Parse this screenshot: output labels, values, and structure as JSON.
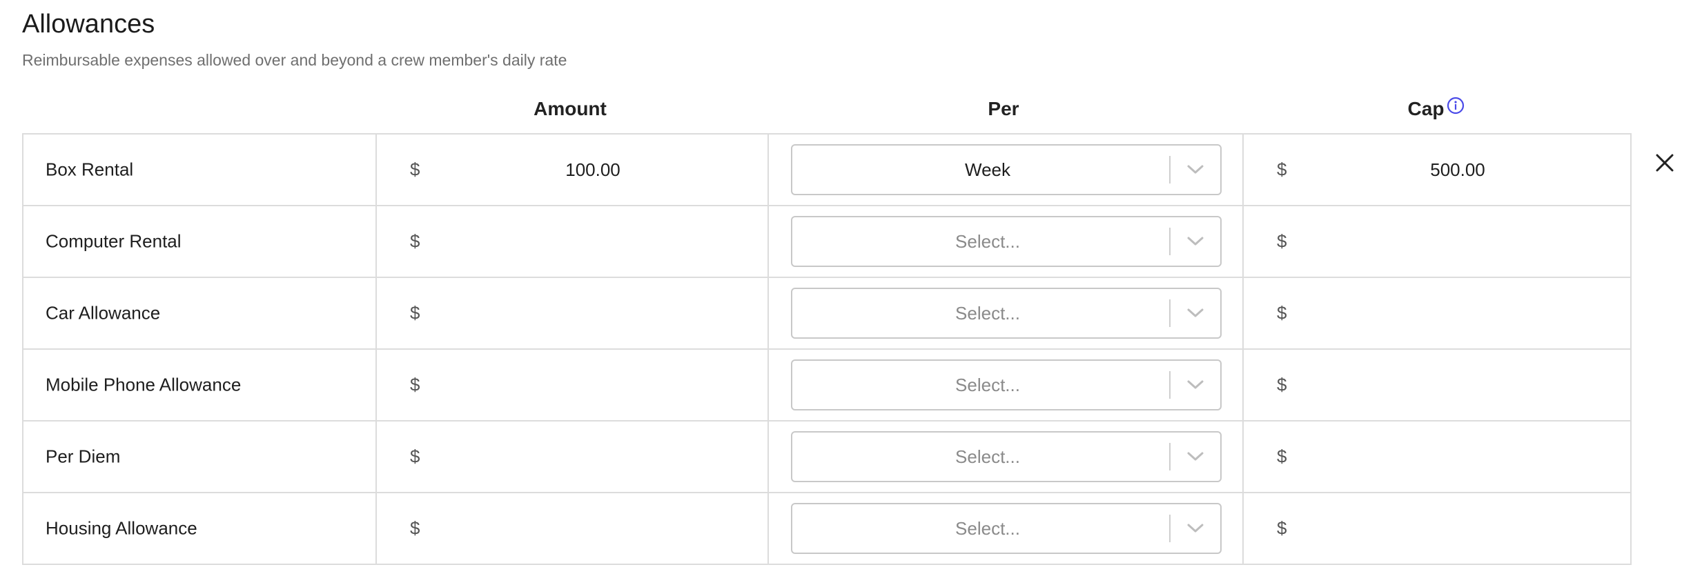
{
  "header": {
    "title": "Allowances",
    "subtitle": "Reimbursable expenses allowed over and beyond a crew member's daily rate"
  },
  "columns": {
    "amount": "Amount",
    "per": "Per",
    "cap": "Cap"
  },
  "currency_symbol": "$",
  "rows": [
    {
      "name": "Box Rental",
      "amount": "100.00",
      "per": "Week",
      "per_placeholder": "Select...",
      "cap": "500.00"
    },
    {
      "name": "Computer Rental",
      "amount": "",
      "per": "",
      "per_placeholder": "Select...",
      "cap": ""
    },
    {
      "name": "Car Allowance",
      "amount": "",
      "per": "",
      "per_placeholder": "Select...",
      "cap": ""
    },
    {
      "name": "Mobile Phone Allowance",
      "amount": "",
      "per": "",
      "per_placeholder": "Select...",
      "cap": ""
    },
    {
      "name": "Per Diem",
      "amount": "",
      "per": "",
      "per_placeholder": "Select...",
      "cap": ""
    },
    {
      "name": "Housing Allowance",
      "amount": "",
      "per": "",
      "per_placeholder": "Select...",
      "cap": ""
    }
  ],
  "icons": {
    "info": "info-icon",
    "chevron": "chevron-down-icon",
    "close": "close-icon"
  },
  "colors": {
    "accent": "#4a4ae8",
    "border": "#dcdcdc",
    "placeholder": "#8a8a8a"
  }
}
